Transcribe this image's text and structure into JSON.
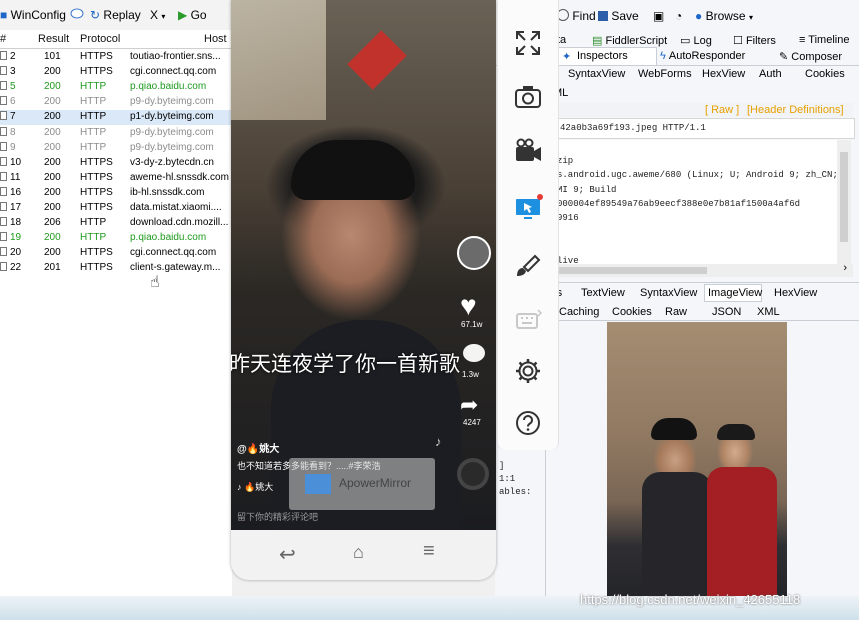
{
  "toolbar": {
    "winconfig": "WinConfig",
    "replay": "Replay",
    "remove": "X",
    "go": "Go"
  },
  "sessions": {
    "headers": {
      "num": "#",
      "result": "Result",
      "protocol": "Protocol",
      "host": "Host"
    },
    "rows": [
      {
        "num": "2",
        "result": "101",
        "protocol": "HTTPS",
        "host": "toutiao-frontier.sns...",
        "color": "#000000"
      },
      {
        "num": "3",
        "result": "200",
        "protocol": "HTTPS",
        "host": "cgi.connect.qq.com",
        "color": "#000000"
      },
      {
        "num": "5",
        "result": "200",
        "protocol": "HTTP",
        "host": "p.qiao.baidu.com",
        "color": "#1e9a1e"
      },
      {
        "num": "6",
        "result": "200",
        "protocol": "HTTP",
        "host": "p9-dy.byteimg.com",
        "color": "#8c8c8c"
      },
      {
        "num": "7",
        "result": "200",
        "protocol": "HTTP",
        "host": "p1-dy.byteimg.com",
        "color": "#000000"
      },
      {
        "num": "8",
        "result": "200",
        "protocol": "HTTP",
        "host": "p9-dy.byteimg.com",
        "color": "#8c8c8c"
      },
      {
        "num": "9",
        "result": "200",
        "protocol": "HTTP",
        "host": "p9-dy.byteimg.com",
        "color": "#8c8c8c"
      },
      {
        "num": "10",
        "result": "200",
        "protocol": "HTTPS",
        "host": "v3-dy-z.bytecdn.cn",
        "color": "#000000"
      },
      {
        "num": "11",
        "result": "200",
        "protocol": "HTTPS",
        "host": "aweme-hl.snssdk.com",
        "color": "#000000"
      },
      {
        "num": "16",
        "result": "200",
        "protocol": "HTTPS",
        "host": "ib-hl.snssdk.com",
        "color": "#000000"
      },
      {
        "num": "17",
        "result": "200",
        "protocol": "HTTPS",
        "host": "data.mistat.xiaomi....",
        "color": "#000000"
      },
      {
        "num": "18",
        "result": "206",
        "protocol": "HTTP",
        "host": "download.cdn.mozill...",
        "color": "#000000"
      },
      {
        "num": "19",
        "result": "200",
        "protocol": "HTTP",
        "host": "p.qiao.baidu.com",
        "color": "#1e9a1e"
      },
      {
        "num": "20",
        "result": "200",
        "protocol": "HTTPS",
        "host": "cgi.connect.qq.com",
        "color": "#000000"
      },
      {
        "num": "22",
        "result": "201",
        "protocol": "HTTPS",
        "host": "client-s.gateway.m...",
        "color": "#000000"
      }
    ]
  },
  "fiddler": {
    "find": "Find",
    "save": "Save",
    "browse": "Browse",
    "tabs_top": [
      "FiddlerScript",
      "Log",
      "Filters",
      "Timeline"
    ],
    "tabs_second": [
      "Inspectors",
      "AutoResponder",
      "Composer"
    ],
    "request_tabs": [
      "SyntaxView",
      "WebForms",
      "HexView",
      "Auth",
      "Cookies"
    ],
    "request_tabs_partial": [
      "ta",
      "ML"
    ],
    "raw_links": [
      "[ Raw ]",
      "[Header Definitions]"
    ],
    "request_line": "42a0b3a69f193.jpeg HTTP/1.1",
    "header_lines": [
      "zip",
      "s.android.ugc.aweme/680 (Linux; U; Android 9; zh_CN; MI 9; Build",
      "",
      "000004ef89549a76ab9eecf388e0e7b81af1500a4af6d",
      "9916",
      "",
      "",
      "live"
    ],
    "response_tabs_1": [
      "rs",
      "TextView",
      "SyntaxView",
      "ImageView",
      "HexView"
    ],
    "response_tabs_2": [
      "Caching",
      "Cookies",
      "Raw",
      "JSON",
      "XML"
    ],
    "side_text": [
      "]",
      "1:1",
      "ables:"
    ]
  },
  "phone": {
    "banner_text": "昨天连夜学了你一首新歌",
    "like_count": "67.1w",
    "comment_count": "1.3w",
    "share_count": "4247",
    "author": "@🔥姚大",
    "caption": "也不知道若多多能看到？.....#李荣浩",
    "music": "♪ 🔥姚大",
    "comment_placeholder": "留下你的精彩评论吧",
    "watermark": "ApowerMirror"
  },
  "footer": {
    "blog_watermark": "https://blog.csdn.net/weixin_42655118"
  },
  "colors": {
    "accent_blue": "#1e66c8",
    "raw_orange": "#e8a000",
    "green_row": "#1e9a1e",
    "selected_row": "#dbe8f7"
  }
}
